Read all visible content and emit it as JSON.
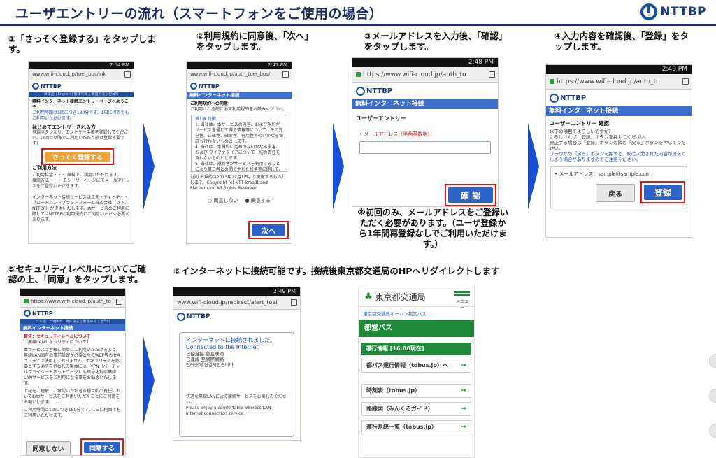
{
  "header": {
    "title": "ユーザエントリーの流れ（スマートフォンをご使用の場合）",
    "logo_text": "NTTBP"
  },
  "steps": [
    {
      "label": "①「さっそく登録する」をタップします。"
    },
    {
      "label": "②利用規約に同意後、「次へ」をタップします。"
    },
    {
      "label": "③メールアドレスを入力後、「確認」をタップします。"
    },
    {
      "label": "④入力内容を確認後、「登録」をタップします。"
    },
    {
      "label": "⑤セキュリティレベルについてご確認の上、「同意」をタップします。"
    },
    {
      "label": "⑥インターネットに接続可能です。接続後東京都交通局のHPへリダイレクトします"
    }
  ],
  "note": "※初回のみ、メールアドレスをご登録いただく必要があります。（ユーザ登録から1年間再登録なしでご利用いただけます。）",
  "screen1": {
    "time": "7:54 PM",
    "url": "www.wifi-cloud.jp/toei_bus/ink",
    "brand": "NTTBP",
    "nav": "日本語 | English | 簡体中文 | 繁體中文 | 한국어",
    "heading": "無料インターネット接続エントリーページへようこそ",
    "notice": "ご利用時間は1回につき180分です。1日に何回でもご利用いただけます。",
    "first_title": "はじめてエントリーされる方",
    "first_text": "登録ボタンより、エントリー手順を登録してください。(2回目以降でご利用いただく際は登録不要です)",
    "button": "さっそく登録する",
    "method_title": "ご利用方法",
    "method_rows": [
      "ご利用料金・・・ 無料でご利用いただけます。",
      "接続方法・・・ エントリーページにてメールアドレスをご登録いただきます。"
    ],
    "footer": "インターネット接続サービスはエヌ・ティ・ティ・ブロードバンドプラットフォーム株式会社（以下、NTTBP）が提供いたします。本サービスのご利用に際してはNTTBPの利用規約にご同意いただく必要があります。"
  },
  "screen2": {
    "time": "2:47 PM",
    "url": "www.wifi-cloud.jp/auth_toei_bus/",
    "band": "無料インターネット接続",
    "terms_title": "ご利用規約への同意",
    "terms_sub": "ご利用される前に必ず利用規約をお読みください。",
    "terms_chapter": "第1章 総則",
    "terms_body": "1. 当社は、本サービスの内容、および規約がサービスを通じて得る情報等について、その完全性、正確性、確実性、有用性等のいかなる保証も行わないものとします。",
    "terms_body2": "4. 当社は、本規約に定めのないかなる損害、および ワイファクイアについて一切の責任を負わないものとします。",
    "terms_body3": "5. 当社は、規約者がサービスを利用することにより第三者との間で生じた紛争等に関して、一切責任を負わないものとします。",
    "copyright": "付則 本規約は2013年12月1日より実施するものとします。Copyright (c) NTT Broadband Platform,Inc All Rights Reserved",
    "disagree": "同意しない",
    "agree": "同意する",
    "button": "次へ"
  },
  "screen3": {
    "time": "2:48 PM",
    "url": "https://www.wifi-cloud.jp/auth_to",
    "band": "無料インターネット接続",
    "title": "ユーザーエントリー",
    "field_label": "メールアドレス（半角英数字）：",
    "button": "確 認"
  },
  "screen4": {
    "time": "2:49 PM",
    "url": "https://www.wifi-cloud.jp/auth_to",
    "band": "無料インターネット接続",
    "title": "ユーザーエントリー 確認",
    "q": "以下の項目でよろしいですか？",
    "line1": "よろしければ「登録」ボタンを押してください。",
    "line2": "修正する場合は「登録」ボタンの隣の「戻る」ボタンを押してください。",
    "warn": "ブラウザの「戻る」ボタンを押すと、既に入力された内容が消えてしまう場合がありますのでご注意ください。",
    "email_row": "メールアドレス：sample@sample.com",
    "back": "戻る",
    "button": "登録"
  },
  "screen5": {
    "url": "https://www.wifi-cloud.jp/auth_to",
    "nav": "日本語 | English | 简体中文 | 繁體中文 | 한국어",
    "band": "無料インターネット接続",
    "warn_title": "警告：セキュリティレベルについて",
    "warn_sub": "【無線LANセキュリティについて】",
    "body": "本サービスは皆様に簡単にご利用いただけるよう、無線LAN固有の事前設定が必要となるWEP等のセキュリティは使用しておりません。セキュリティを必要とする通信を行われる場合には、VPN（バーチャルプライベートネットワーク）や暗号化対応無線LANサービスをご利用になる事をお勧めいたします。",
    "body2": "上記をご理解、ご承認いただき各種目的の責任においてお本サービスをご利用いただくことにご同意をお願いします。",
    "limit": "ご利用時間は1回につき180分です。1日に何回でもご利用いただけます。",
    "disagree": "同意しない",
    "button": "同意する"
  },
  "screen6": {
    "time": "2:49 PM",
    "url": "www.wifi-cloud.jp/redirect/alert_toei",
    "connected_jp": "インターネットに接続されました。",
    "connected_en": "Connected to the Internet",
    "lines": [
      "已经连接 至互联网",
      "已連線 至網際網路",
      "인터넷에 연결되었습니다"
    ],
    "footer_jp": "快適な無線LANによる接続サービスをお楽しみください。",
    "footer_en": "Please enjoy a comfortable wireless LAN internet connection service."
  },
  "toei": {
    "name": "東京都交通局",
    "menu": "メニュー",
    "breadcrumb": "東京都交通局ホーム＞都営バス",
    "page_title": "都営バス",
    "running_info": "運行情報 [16:00現在]",
    "rows": [
      "都バス運行情報（tobus.jp）へ",
      "時刻表（tobus.jp）",
      "路線図（みんくるガイド）",
      "運行系統一覧（tobus.jp）"
    ]
  }
}
